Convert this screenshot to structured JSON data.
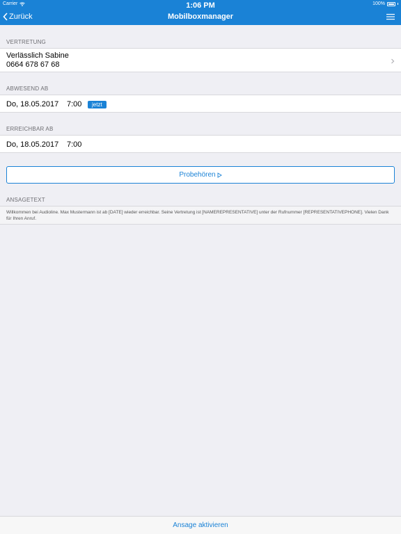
{
  "statusbar": {
    "carrier": "Carrier",
    "time": "1:06 PM",
    "battery": "100%"
  },
  "navbar": {
    "back_label": "Zurück",
    "title": "Mobilboxmanager",
    "menu_icon": "hamburger-menu-icon"
  },
  "sections": {
    "representative": {
      "header": "VERTRETUNG",
      "name": "Verlässlich Sabine",
      "phone": "0664 678 67 68"
    },
    "absent_from": {
      "header": "ABWESEND AB",
      "date": "Do, 18.05.2017",
      "time": "7:00",
      "now_badge": "jetzt"
    },
    "reachable_from": {
      "header": "ERREICHBAR AB",
      "date": "Do, 18.05.2017",
      "time": "7:00"
    },
    "listen_button": {
      "label": "Probehören"
    },
    "announcement": {
      "header": "ANSAGETEXT",
      "text": "Willkommen bei Audioline. Max Mustermann ist ab [DATE] wieder erreichbar. Seine Vertretung ist [NAMEREPRESENTATIVE] unter der Rufnummer [REPRESENTATIVEPHONE]. Vielen Dank für Ihren Anruf."
    }
  },
  "footer": {
    "activate_label": "Ansage aktivieren"
  },
  "colors": {
    "accent": "#1a82d6",
    "background": "#efeff4",
    "cell": "#ffffff",
    "section_text": "#6d6d72"
  }
}
